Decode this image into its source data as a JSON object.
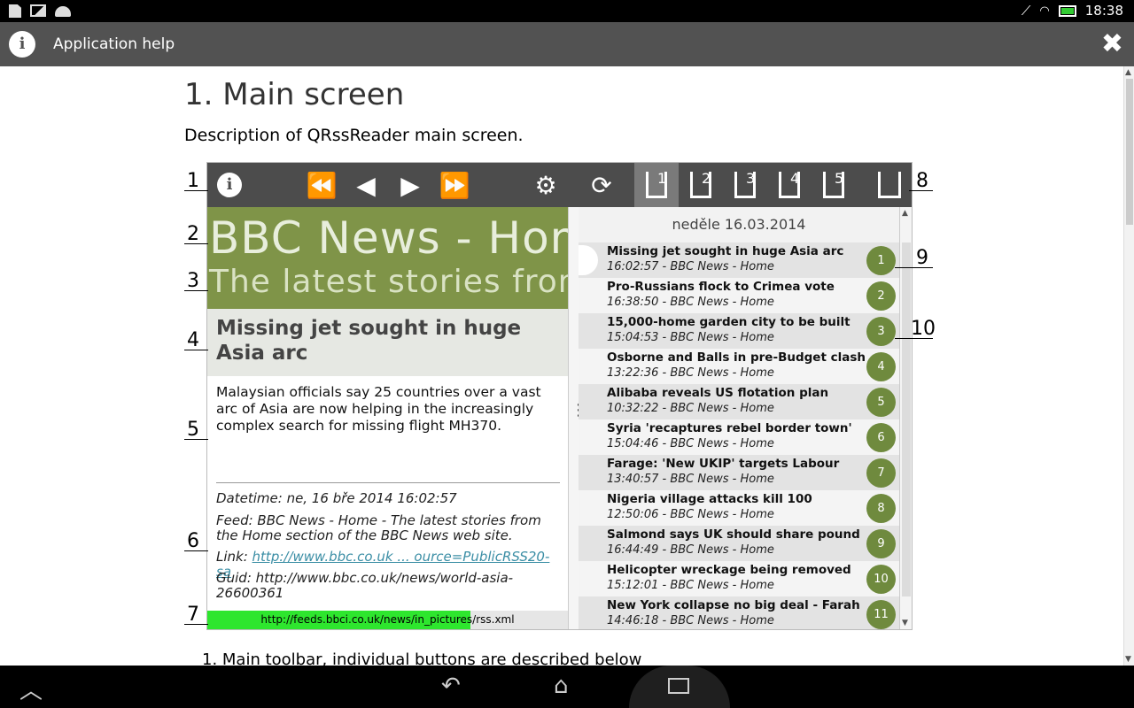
{
  "status_bar": {
    "time": "18:38"
  },
  "action_bar": {
    "title": "Application help",
    "close_label": "✖"
  },
  "content": {
    "heading": "1. Main screen",
    "description": "Description of QRssReader main screen.",
    "list_item_1": "1. Main toolbar, individual buttons are described below"
  },
  "figure": {
    "toolbar": {
      "feed_tabs": [
        "1",
        "2",
        "3",
        "4",
        "5"
      ]
    },
    "left_pane": {
      "feed_title": "BBC News - Home",
      "feed_subtitle": "The latest stories from the Home section",
      "article_title": "Missing jet sought in huge Asia arc",
      "article_desc": "Malaysian officials say 25 countries over a vast arc of Asia are now helping in the increasingly complex search for missing flight MH370.",
      "datetime": "Datetime: ne, 16 bře 2014 16:02:57",
      "feed_info": "Feed: BBC News - Home - The latest stories from the Home section of the BBC News web site.",
      "link_label": "Link: ",
      "link_url": "http://www.bbc.co.uk ... ource=PublicRSS20-sa",
      "guid": "Guid: http://www.bbc.co.uk/news/world-asia-26600361",
      "status_url": "http://feeds.bbci.co.uk/news/in_pictures/rss.xml",
      "progress": 0.73
    },
    "right_pane": {
      "date_header": "neděle 16.03.2014",
      "items": [
        {
          "title": "Missing jet sought in huge Asia arc",
          "sub": "16:02:57 - BBC News - Home",
          "num": "1"
        },
        {
          "title": "Pro-Russians flock to Crimea vote",
          "sub": "16:38:50 - BBC News - Home",
          "num": "2"
        },
        {
          "title": "15,000-home garden city to be built",
          "sub": "15:04:53 - BBC News - Home",
          "num": "3"
        },
        {
          "title": "Osborne and Balls in pre-Budget clash",
          "sub": "13:22:36 - BBC News - Home",
          "num": "4"
        },
        {
          "title": "Alibaba reveals US flotation plan",
          "sub": "10:32:22 - BBC News - Home",
          "num": "5"
        },
        {
          "title": "Syria 'recaptures rebel border town'",
          "sub": "15:04:46 - BBC News - Home",
          "num": "6"
        },
        {
          "title": "Farage: 'New UKIP' targets Labour",
          "sub": "13:40:57 - BBC News - Home",
          "num": "7"
        },
        {
          "title": "Nigeria village attacks kill 100",
          "sub": "12:50:06 - BBC News - Home",
          "num": "8"
        },
        {
          "title": "Salmond says UK should share pound",
          "sub": "16:44:49 - BBC News - Home",
          "num": "9"
        },
        {
          "title": "Helicopter wreckage being removed",
          "sub": "15:12:01 - BBC News - Home",
          "num": "10"
        },
        {
          "title": "New York collapse no big deal - Farah",
          "sub": "14:46:18 - BBC News - Home",
          "num": "11"
        }
      ]
    },
    "callouts": {
      "c1": "1",
      "c2": "2",
      "c3": "3",
      "c4": "4",
      "c5": "5",
      "c6": "6",
      "c7": "7",
      "c8": "8",
      "c9": "9",
      "c10": "10"
    }
  },
  "colors": {
    "toolbar": "#4c4c4c",
    "banner": "#7f9448",
    "badge": "#6f8a3e",
    "progress": "#2ee62e",
    "link": "#3b8ea5"
  }
}
